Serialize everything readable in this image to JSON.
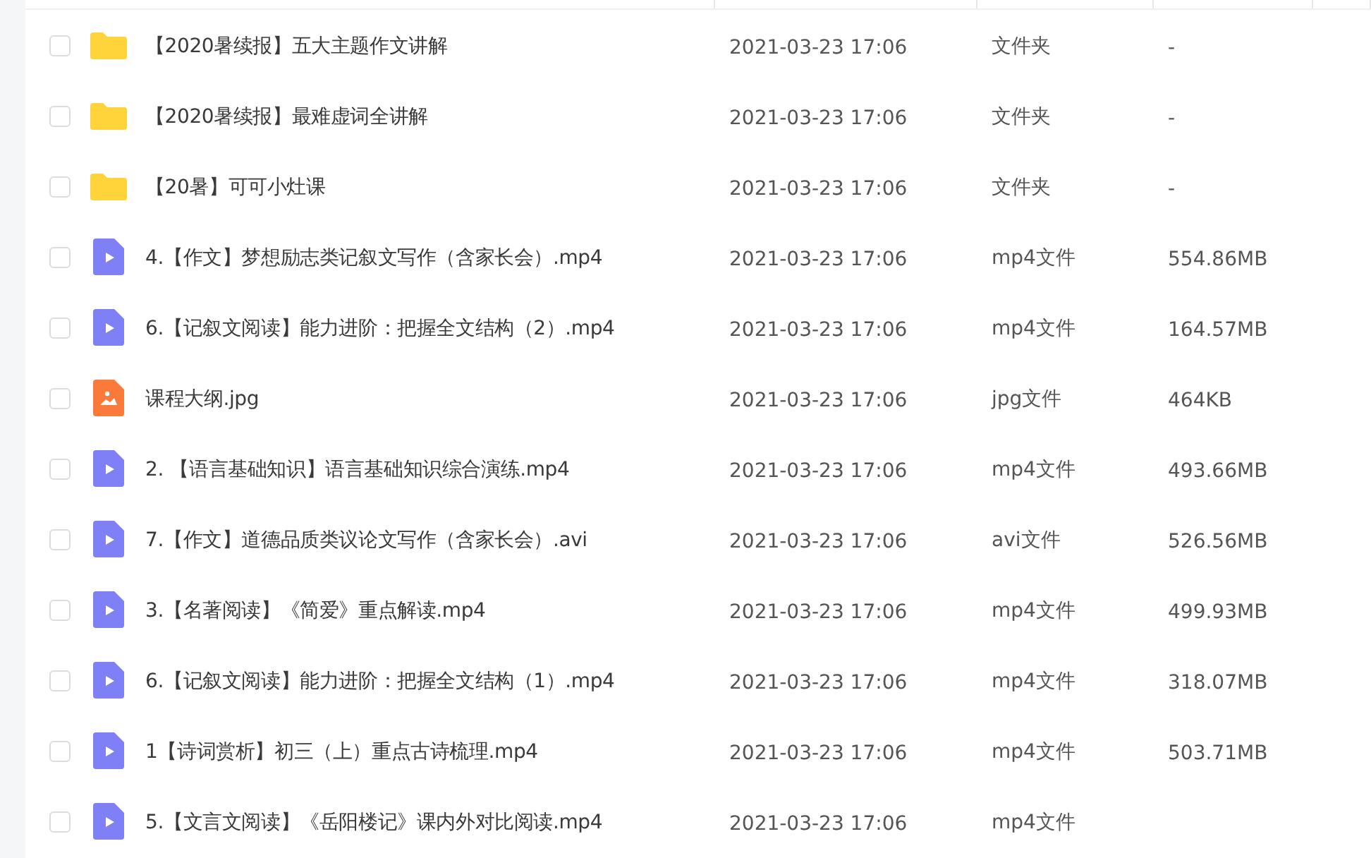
{
  "files": [
    {
      "kind": "folder",
      "name": "【2020暑续报】五大主题作文讲解",
      "date": "2021-03-23 17:06",
      "type": "文件夹",
      "size": "-",
      "checked": false
    },
    {
      "kind": "folder",
      "name": "【2020暑续报】最难虚词全讲解",
      "date": "2021-03-23 17:06",
      "type": "文件夹",
      "size": "-",
      "checked": false
    },
    {
      "kind": "folder",
      "name": "【20暑】可可小灶课",
      "date": "2021-03-23 17:06",
      "type": "文件夹",
      "size": "-",
      "checked": false
    },
    {
      "kind": "video",
      "name": "4.【作文】梦想励志类记叙文写作（含家长会）.mp4",
      "date": "2021-03-23 17:06",
      "type": "mp4文件",
      "size": "554.86MB",
      "checked": false
    },
    {
      "kind": "video",
      "name": "6.【记叙文阅读】能力进阶：把握全文结构（2）.mp4",
      "date": "2021-03-23 17:06",
      "type": "mp4文件",
      "size": "164.57MB",
      "checked": false
    },
    {
      "kind": "image",
      "name": "课程大纲.jpg",
      "date": "2021-03-23 17:06",
      "type": "jpg文件",
      "size": "464KB",
      "checked": false
    },
    {
      "kind": "video",
      "name": "2. 【语言基础知识】语言基础知识综合演练.mp4",
      "date": "2021-03-23 17:06",
      "type": "mp4文件",
      "size": "493.66MB",
      "checked": false
    },
    {
      "kind": "video",
      "name": "7.【作文】道德品质类议论文写作（含家长会）.avi",
      "date": "2021-03-23 17:06",
      "type": "avi文件",
      "size": "526.56MB",
      "checked": false
    },
    {
      "kind": "video",
      "name": "3.【名著阅读】《简爱》重点解读.mp4",
      "date": "2021-03-23 17:06",
      "type": "mp4文件",
      "size": "499.93MB",
      "checked": false
    },
    {
      "kind": "video",
      "name": "6.【记叙文阅读】能力进阶：把握全文结构（1）.mp4",
      "date": "2021-03-23 17:06",
      "type": "mp4文件",
      "size": "318.07MB",
      "checked": false
    },
    {
      "kind": "video",
      "name": "1【诗词赏析】初三（上）重点古诗梳理.mp4",
      "date": "2021-03-23 17:06",
      "type": "mp4文件",
      "size": "503.71MB",
      "checked": false
    },
    {
      "kind": "video",
      "name": "5.【文言文阅读】《岳阳楼记》课内外对比阅读.mp4",
      "date": "2021-03-23 17:06",
      "type": "mp4文件",
      "checked": false
    }
  ]
}
